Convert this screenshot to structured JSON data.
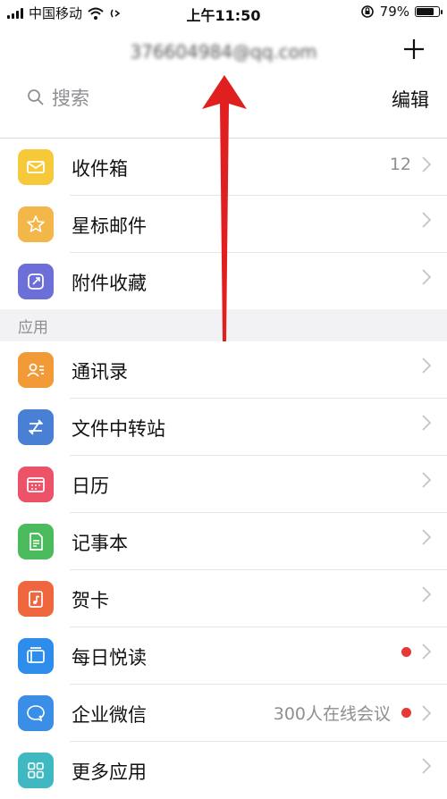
{
  "status_bar": {
    "carrier": "中国移动",
    "time": "上午11:50",
    "battery_percent": "79%",
    "battery_level": 0.79
  },
  "header": {
    "account_email": "376604984@qq.com"
  },
  "search": {
    "placeholder": "搜索",
    "edit_label": "编辑"
  },
  "mail_items": [
    {
      "label": "收件箱",
      "count": "12",
      "icon": "inbox-icon",
      "color": "#F5C93A"
    },
    {
      "label": "星标邮件",
      "icon": "star-icon",
      "color": "#F3B648"
    },
    {
      "label": "附件收藏",
      "icon": "attachment-icon",
      "color": "#6C6FD8"
    }
  ],
  "apps_section": {
    "title": "应用",
    "items": [
      {
        "label": "通讯录",
        "icon": "contacts-icon",
        "color": "#F29A38"
      },
      {
        "label": "文件中转站",
        "icon": "transfer-icon",
        "color": "#4A7FD6"
      },
      {
        "label": "日历",
        "icon": "calendar-icon",
        "color": "#EE5268"
      },
      {
        "label": "记事本",
        "icon": "notepad-icon",
        "color": "#4CBB5E"
      },
      {
        "label": "贺卡",
        "icon": "greeting-card-icon",
        "color": "#F0663E"
      },
      {
        "label": "每日悦读",
        "icon": "reader-icon",
        "color": "#2E8CEB",
        "badge": "red-dot"
      },
      {
        "label": "企业微信",
        "icon": "wework-icon",
        "color": "#3A8EE6",
        "detail": "300人在线会议",
        "badge": "red-dot"
      },
      {
        "label": "更多应用",
        "icon": "more-apps-icon",
        "color": "#3FB8C2"
      }
    ]
  },
  "colors": {
    "accent_red": "#E53935",
    "secondary_text": "#8E8E93",
    "section_bg": "#F2F2F4"
  }
}
